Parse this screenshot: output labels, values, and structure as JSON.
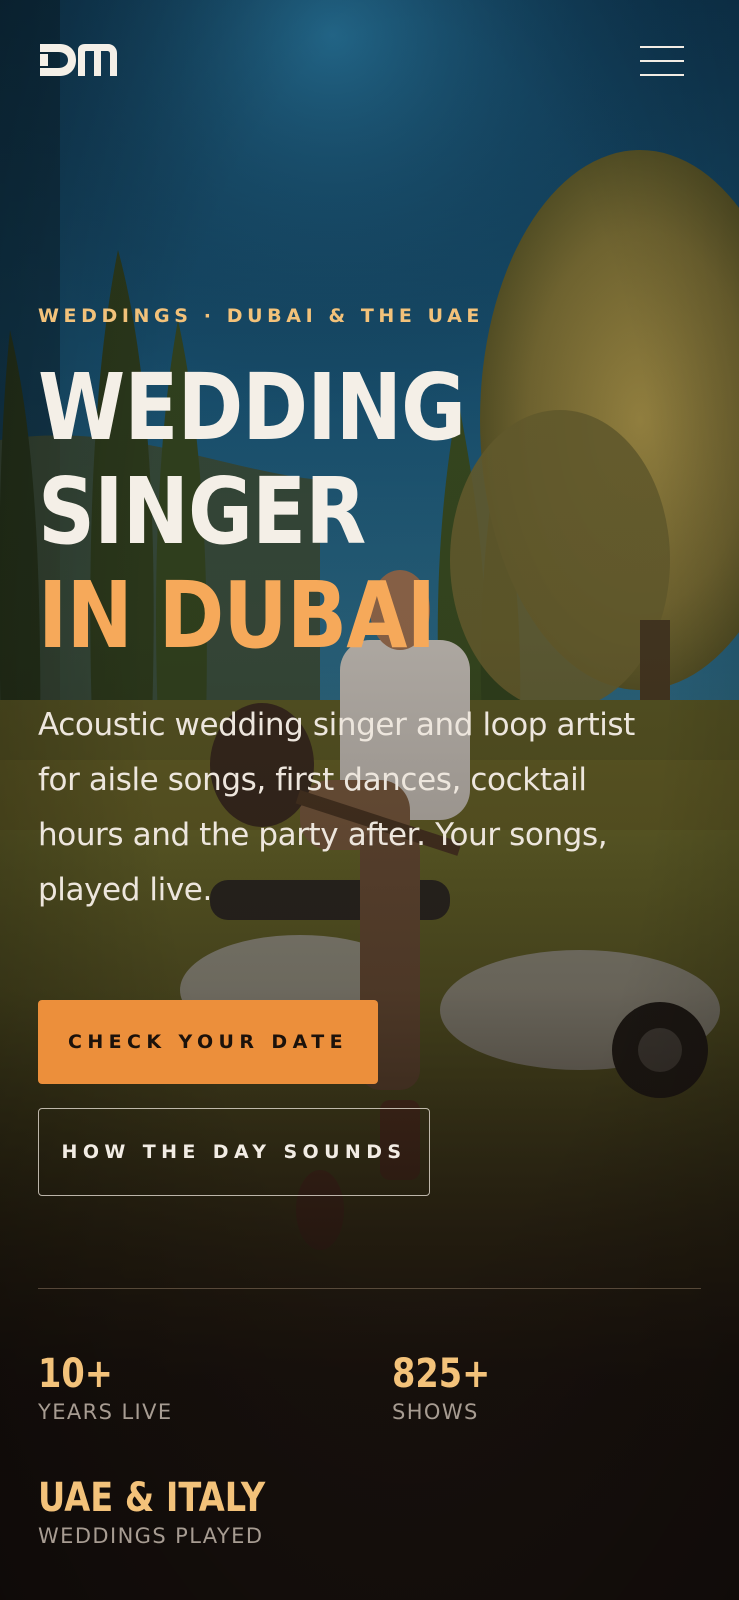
{
  "header": {
    "logo_text": "DM",
    "menu_icon": "hamburger-menu-icon"
  },
  "hero": {
    "eyebrow": "WEDDINGS · DUBAI & THE UAE",
    "title_part1": "WEDDING SINGER ",
    "title_part2": "IN DUBAI",
    "description": "Acoustic wedding singer and loop artist for aisle songs, first dances, cocktail hours and the party after. Your songs, played live."
  },
  "actions": {
    "primary_label": "CHECK YOUR DATE",
    "secondary_label": "HOW THE DAY SOUNDS"
  },
  "stats": [
    {
      "value": "10+",
      "label": "YEARS LIVE"
    },
    {
      "value": "825+",
      "label": "SHOWS"
    },
    {
      "value": "UAE & ITALY",
      "label": "WEDDINGS PLAYED"
    }
  ],
  "colors": {
    "accent": "#f6a95a",
    "eyebrow": "#f3c27a",
    "button": "#ec8f3b",
    "background_dark": "#17100d"
  }
}
